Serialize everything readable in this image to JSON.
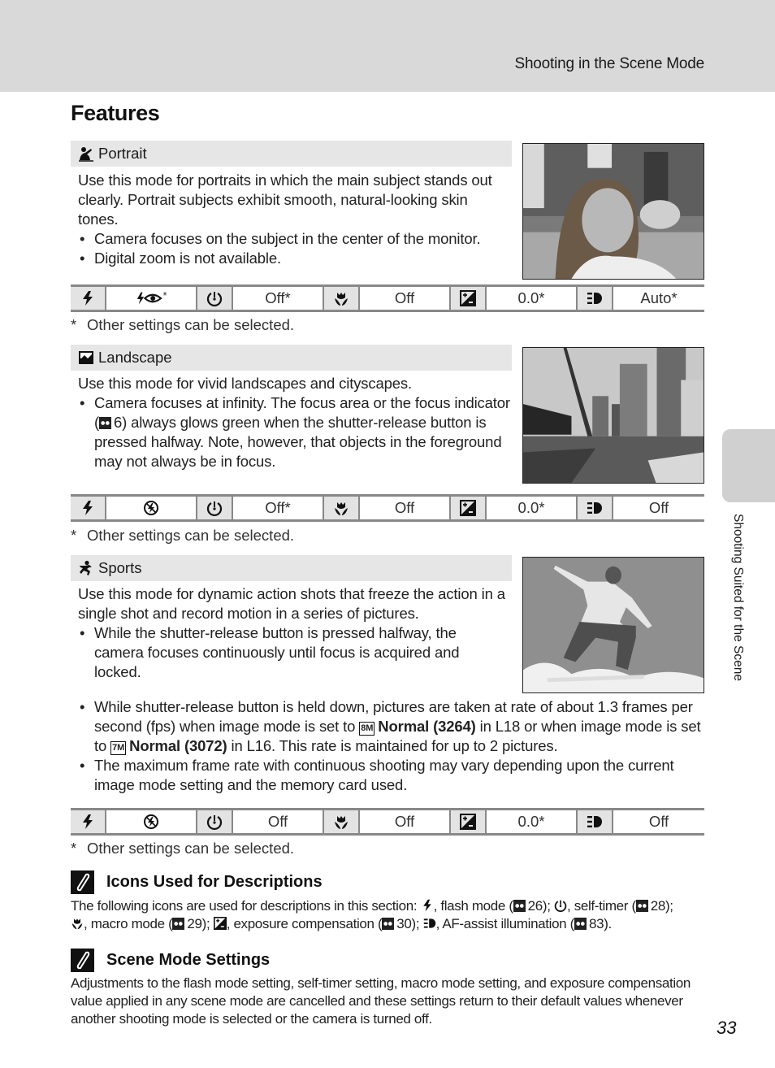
{
  "header": {
    "section_title": "Shooting in the Scene Mode"
  },
  "page_title": "Features",
  "modes": [
    {
      "id": "portrait",
      "icon": "portrait-icon",
      "title": "Portrait",
      "description": "Use this mode for portraits in which the main subject stands out clearly. Portrait subjects exhibit smooth, natural-looking skin tones.",
      "bullets": [
        "Camera focuses on the subject in the center of the monitor.",
        "Digital zoom is not available."
      ],
      "photo": "portrait-photo",
      "settings": {
        "flash": "∗",
        "self_timer": "Off*",
        "macro": "Off",
        "exposure": "0.0*",
        "af_assist": "Auto*"
      },
      "flash_icon": "red-eye-reduction-icon",
      "footnote": "Other settings can be selected."
    },
    {
      "id": "landscape",
      "icon": "landscape-icon",
      "title": "Landscape",
      "description": "Use this mode for vivid landscapes and cityscapes.",
      "bullets": [
        "Camera focuses at infinity. The focus area or the focus indicator (",
        "6) always glows green when the shutter-release button is pressed halfway. Note, however, that objects in the foreground may not always be in focus."
      ],
      "photo": "landscape-photo",
      "settings": {
        "flash": "",
        "self_timer": "Off*",
        "macro": "Off",
        "exposure": "0.0*",
        "af_assist": "Off"
      },
      "flash_icon": "flash-off-icon",
      "footnote": "Other settings can be selected."
    },
    {
      "id": "sports",
      "icon": "sports-icon",
      "title": "Sports",
      "description": "Use this mode for dynamic action shots that freeze the action in a single shot and record motion in a series of pictures.",
      "bullets": [
        "While the shutter-release button is pressed halfway, the camera focuses continuously until focus is acquired and locked."
      ],
      "extra_bullets": [
        {
          "p1": "While shutter-release button is held down, pictures are taken at rate of about 1.3 frames per second (fps) when image mode is set to ",
          "b1": "Normal (3264)",
          "p2": " in L18 or when image mode is set to ",
          "b2": "Normal (3072)",
          "p3": " in L16. This rate is maintained for up to 2 pictures."
        },
        {
          "text": "The maximum frame rate with continuous shooting may vary depending upon the current image mode setting and the memory card used."
        }
      ],
      "photo": "sports-photo",
      "settings": {
        "flash": "",
        "self_timer": "Off",
        "macro": "Off",
        "exposure": "0.0*",
        "af_assist": "Off"
      },
      "flash_icon": "flash-off-icon",
      "footnote": "Other settings can be selected."
    }
  ],
  "footnote_marker": "*",
  "notes": [
    {
      "title": "Icons Used for Descriptions",
      "parts": {
        "intro": "The following icons are used for descriptions in this section: ",
        "flash": ", flash mode (",
        "flash_ref": "26); ",
        "timer": ", self-timer (",
        "timer_ref": "28);",
        "macro": ", macro mode (",
        "macro_ref": "29); ",
        "exposure": ", exposure compensation (",
        "exposure_ref": "30); ",
        "af": ", AF-assist illumination (",
        "af_ref": "83)."
      }
    },
    {
      "title": "Scene Mode Settings",
      "text": "Adjustments to the flash mode setting, self-timer setting, macro mode setting, and exposure compensation value applied in any scene mode are cancelled and these settings return to their default values whenever another shooting mode is selected or the camera is turned off."
    }
  ],
  "side_tab": {
    "label": "Shooting Suited for the Scene"
  },
  "page_number": "33",
  "image_mode_badges": {
    "eight_m": "8M",
    "seven_m": "7M"
  },
  "portrait_flash_star": "*"
}
